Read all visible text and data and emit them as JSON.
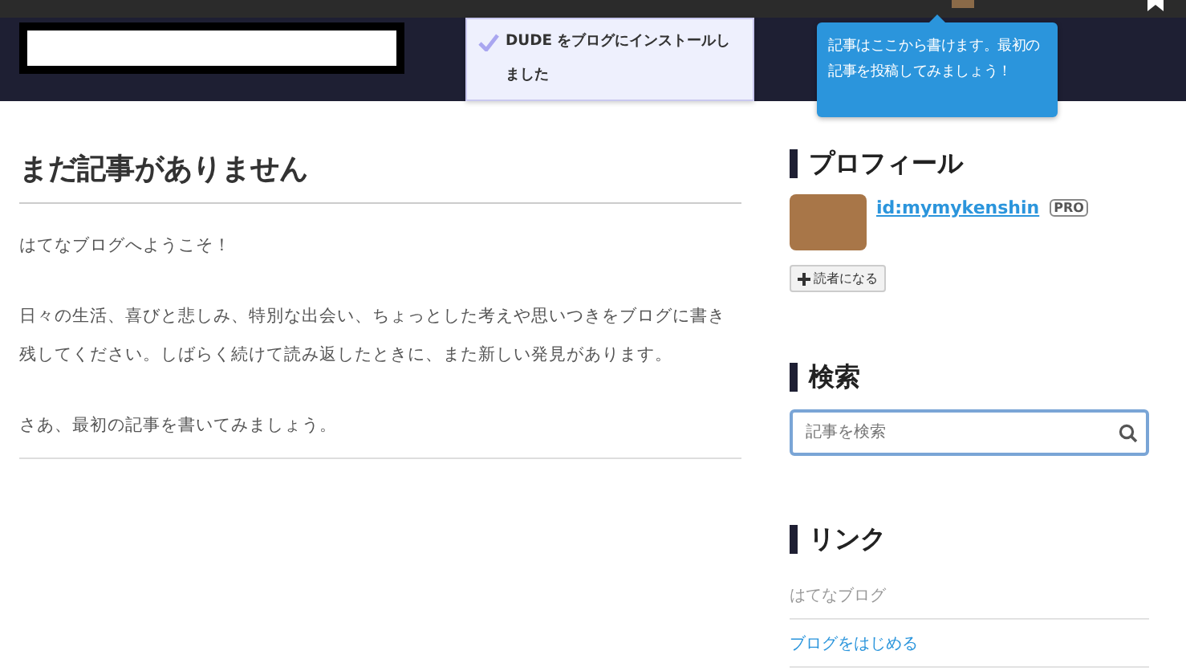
{
  "header": {
    "notification": {
      "text": "DUDE をブログにインストールしました",
      "checked": true
    },
    "tooltip": "記事はここから書けます。最初の記事を投稿してみましょう！"
  },
  "main": {
    "heading": "まだ記事がありません",
    "paragraphs": [
      "はてなブログへようこそ！",
      "日々の生活、喜びと悲しみ、特別な出会い、ちょっとした考えや思いつきをブログに書き残してください。しばらく続けて読み返したときに、また新しい発見があります。",
      "さあ、最初の記事を書いてみましょう。"
    ]
  },
  "sidebar": {
    "profile": {
      "heading": "プロフィール",
      "user_id": "id:mymykenshin",
      "badge": "PRO",
      "follow_button": "読者になる"
    },
    "search": {
      "heading": "検索",
      "placeholder": "記事を検索"
    },
    "links": {
      "heading": "リンク",
      "items": [
        {
          "label": "はてなブログ",
          "visited": true
        },
        {
          "label": "ブログをはじめる",
          "visited": false
        }
      ]
    }
  }
}
